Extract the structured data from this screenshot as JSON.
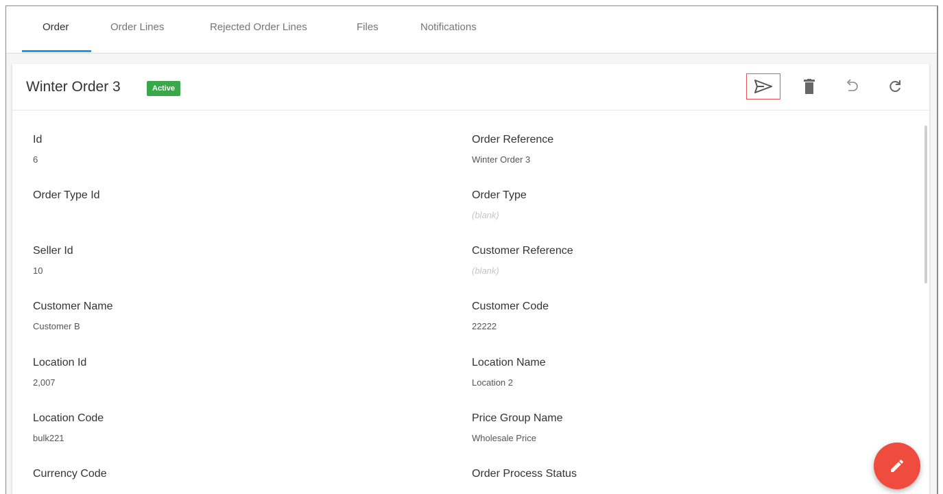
{
  "tabs": [
    {
      "label": "Order"
    },
    {
      "label": "Order Lines"
    },
    {
      "label": "Rejected Order Lines"
    },
    {
      "label": "Files"
    },
    {
      "label": "Notifications"
    }
  ],
  "header": {
    "title": "Winter Order 3",
    "status_badge": "Active"
  },
  "toolbar": {
    "icons": [
      "send-icon",
      "delete-icon",
      "undo-icon",
      "refresh-icon"
    ]
  },
  "fields": {
    "id": {
      "label": "Id",
      "value": "6"
    },
    "order_reference": {
      "label": "Order Reference",
      "value": "Winter Order 3"
    },
    "order_type_id": {
      "label": "Order Type Id",
      "value": ""
    },
    "order_type": {
      "label": "Order Type",
      "value": "(blank)"
    },
    "seller_id": {
      "label": "Seller Id",
      "value": "10"
    },
    "customer_reference": {
      "label": "Customer Reference",
      "value": "(blank)"
    },
    "customer_name": {
      "label": "Customer Name",
      "value": "Customer B"
    },
    "customer_code": {
      "label": "Customer Code",
      "value": "22222"
    },
    "location_id": {
      "label": "Location Id",
      "value": "2,007"
    },
    "location_name": {
      "label": "Location Name",
      "value": "Location 2"
    },
    "location_code": {
      "label": "Location Code",
      "value": "bulk221"
    },
    "price_group_name": {
      "label": "Price Group Name",
      "value": "Wholesale Price"
    },
    "currency_code": {
      "label": "Currency Code"
    },
    "order_process_status": {
      "label": "Order Process Status"
    }
  },
  "colors": {
    "accent": "#2196f3",
    "active_badge": "#3aa84a",
    "fab": "#ef4b3f",
    "highlight_border": "#e0555a"
  },
  "fab": {
    "icon": "edit-pencil-icon"
  }
}
